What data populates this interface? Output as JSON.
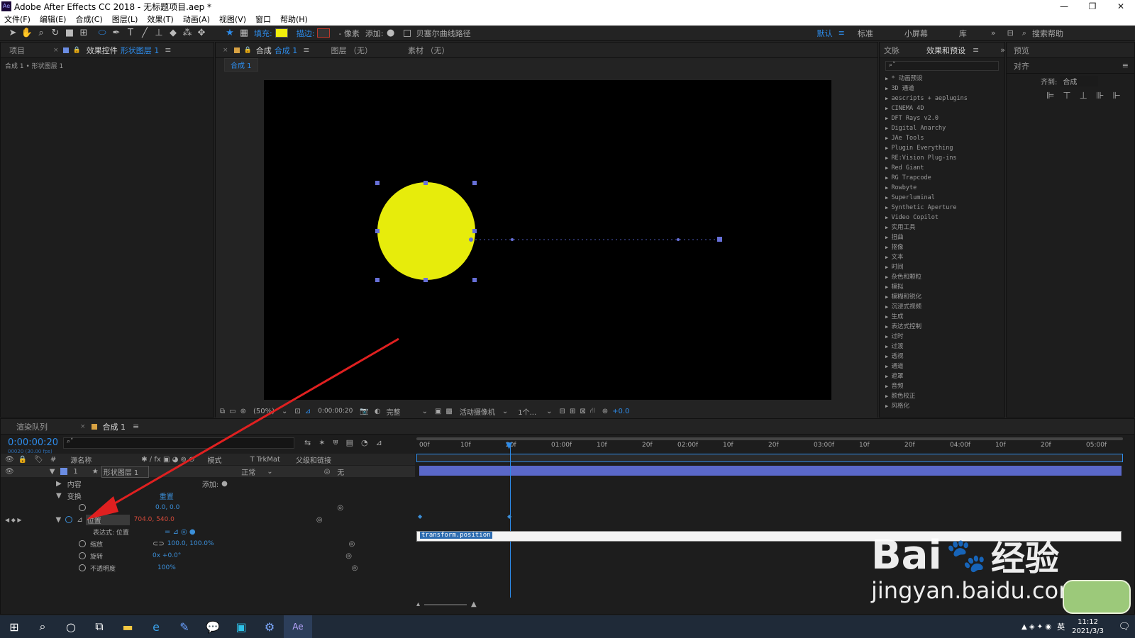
{
  "window": {
    "title": "Adobe After Effects CC 2018 - 无标题项目.aep *",
    "logo": "Ae",
    "minimize": "—",
    "maximize": "❐",
    "close": "✕"
  },
  "menu": [
    "文件(F)",
    "编辑(E)",
    "合成(C)",
    "图层(L)",
    "效果(T)",
    "动画(A)",
    "视图(V)",
    "窗口",
    "帮助(H)"
  ],
  "toolbar": {
    "fill_label": "填充:",
    "stroke_label": "描边:",
    "stroke_px": "- 像素",
    "add_label": "添加:",
    "bezier_label": "贝塞尔曲线路径",
    "workspace_default": "默认",
    "workspace_standard": "标准",
    "workspace_small": "小屏幕",
    "workspace_lib": "库",
    "search_help": "搜索帮助",
    "fill_color": "#f2ee0c",
    "stroke_color": "#c0392b"
  },
  "left_panel": {
    "tab_project": "项目",
    "tab_effects_controls": "效果控件",
    "tab_effects_layer": "形状图层 1",
    "breadcrumb": "合成 1 • 形状图层 1"
  },
  "viewer": {
    "tab_comp_prefix": "合成",
    "tab_comp_name": "合成 1",
    "tab_layer": "图层 （无）",
    "tab_footage": "素材 （无）",
    "comp_chip": "合成 1",
    "zoom": "(50%)",
    "timecode": "0:00:00:20",
    "resolution": "完整",
    "camera": "活动摄像机",
    "views": "1个...",
    "exposure": "+0.0",
    "circle_color": "#e7ec0b"
  },
  "effects_panel": {
    "tab_info": "文脉",
    "tab_effects": "效果和预设",
    "items": [
      "* 动画预设",
      "3D 通道",
      "aescripts + aeplugins",
      "CINEMA 4D",
      "DFT Rays v2.0",
      "Digital Anarchy",
      "JAe Tools",
      "Plugin Everything",
      "RE:Vision Plug-ins",
      "Red Giant",
      "RG Trapcode",
      "Rowbyte",
      "Superluminal",
      "Synthetic Aperture",
      "Video Copilot",
      "实用工具",
      "扭曲",
      "抠像",
      "文本",
      "时间",
      "杂色和颗粒",
      "模拟",
      "模糊和锐化",
      "沉浸式视频",
      "生成",
      "表达式控制",
      "过时",
      "过渡",
      "透视",
      "通道",
      "遮罩",
      "音频",
      "颜色校正",
      "风格化"
    ]
  },
  "right_panel": {
    "tab_preview": "预览",
    "tab_align": "对齐",
    "align_to_label": "齐到:",
    "align_to_value": "合成"
  },
  "timeline": {
    "tab_render": "渲染队列",
    "tab_comp": "合成 1",
    "timecode": "0:00:00:20",
    "timecode_sub": "00020 (30.00 fps)",
    "col_name": "源名称",
    "col_mode": "模式",
    "col_trkmat": "T TrkMat",
    "col_parent": "父级和链接",
    "layer_num": "1",
    "layer_name": "形状图层 1",
    "layer_mode": "正常",
    "layer_parent": "无",
    "contents": "内容",
    "add": "添加:",
    "transform": "变换",
    "reset": "重置",
    "anchor_value": "0.0, 0.0",
    "position_label": "位置",
    "position_value": "704.0, 540.0",
    "expression_label": "表达式: 位置",
    "expression_text": "transform.position",
    "scale_label": "缩放",
    "scale_value": "100.0, 100.0%",
    "rotation_label": "旋转",
    "rotation_value": "0x +0.0°",
    "opacity_label": "不透明度",
    "opacity_value": "100%",
    "ruler": [
      "00f",
      "10f",
      "20f",
      "01:00f",
      "10f",
      "20f",
      "02:00f",
      "10f",
      "20f",
      "03:00f",
      "10f",
      "20f",
      "04:00f",
      "10f",
      "20f",
      "05:00f"
    ]
  },
  "watermark": {
    "brand": "Bai",
    "brand2": "经验",
    "url": "jingyan.baidu.com"
  },
  "taskbar": {
    "time": "11:12",
    "date": "2021/3/3",
    "lang": "英"
  }
}
